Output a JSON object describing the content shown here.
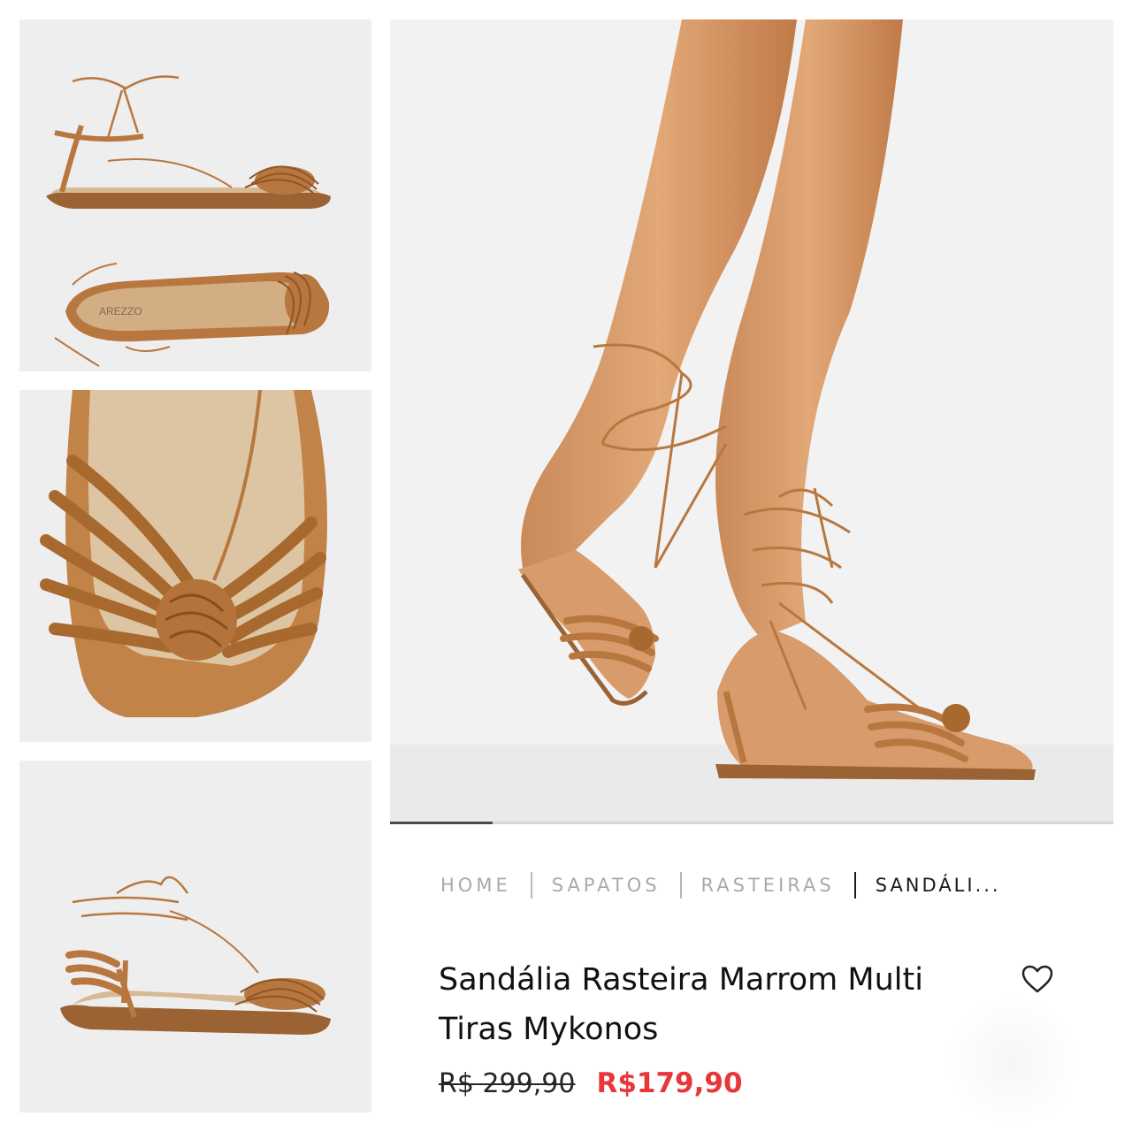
{
  "gallery": {
    "thumbnails": [
      {
        "name": "side and top view of lace-up sandal"
      },
      {
        "name": "close-up of braided knot strap"
      },
      {
        "name": "rear three-quarter view of sandal"
      }
    ],
    "main_image": {
      "name": "model wearing lace-up braided sandals"
    },
    "insole_brand": "AREZZO"
  },
  "breadcrumb": {
    "items": [
      "HOME",
      "SAPATOS",
      "RASTEIRAS",
      "SANDÁLI..."
    ]
  },
  "product": {
    "title": "Sandália Rasteira Marrom Multi Tiras Mykonos",
    "old_price": "R$ 299,90",
    "price": "R$179,90"
  },
  "icons": {
    "favorite": "heart-icon"
  },
  "colors": {
    "leather": "#b8773f",
    "sale_price": "#e7373a",
    "background": "#eeeeee"
  }
}
